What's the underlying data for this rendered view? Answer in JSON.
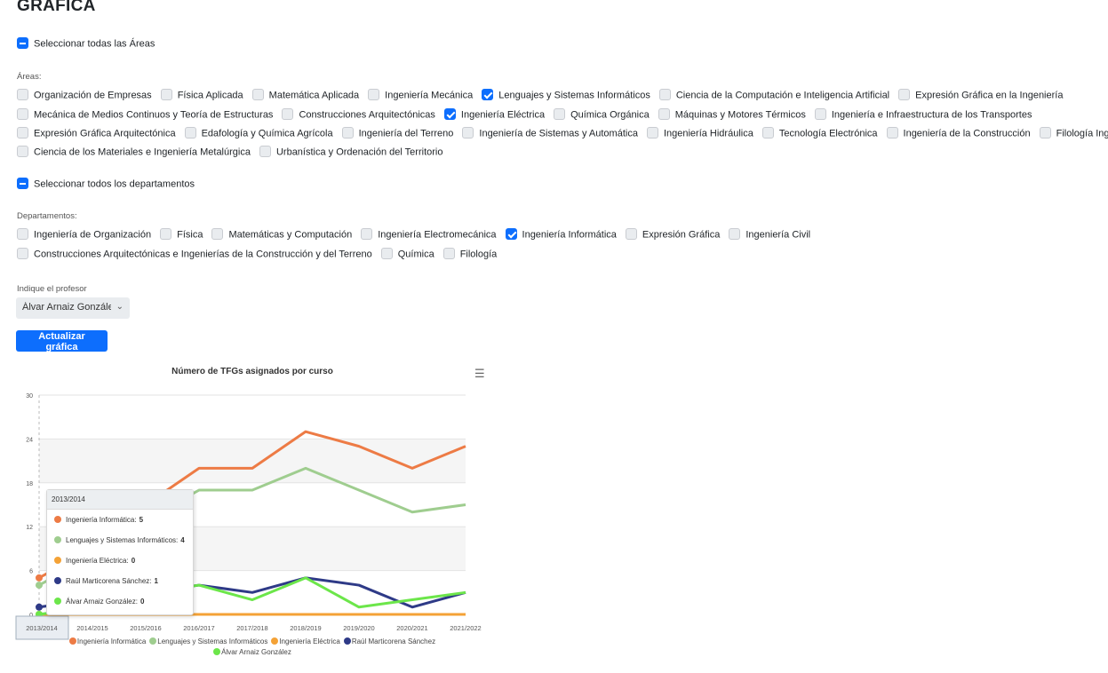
{
  "page": {
    "title": "GRÁFICA"
  },
  "areas": {
    "select_all_label": "Seleccionar todas las Áreas",
    "section_label": "Áreas:",
    "rows": [
      [
        {
          "label": "Organización de Empresas",
          "checked": false
        },
        {
          "label": "Física Aplicada",
          "checked": false
        },
        {
          "label": "Matemática Aplicada",
          "checked": false
        },
        {
          "label": "Ingeniería Mecánica",
          "checked": false
        },
        {
          "label": "Lenguajes y Sistemas Informáticos",
          "checked": true
        },
        {
          "label": "Ciencia de la Computación e Inteligencia Artificial",
          "checked": false
        },
        {
          "label": "Expresión Gráfica en la Ingeniería",
          "checked": false
        }
      ],
      [
        {
          "label": "Mecánica de Medios Continuos y Teoría de Estructuras",
          "checked": false
        },
        {
          "label": "Construcciones Arquitectónicas",
          "checked": false
        },
        {
          "label": "Ingeniería Eléctrica",
          "checked": true
        },
        {
          "label": "Química Orgánica",
          "checked": false
        },
        {
          "label": "Máquinas y Motores Térmicos",
          "checked": false
        },
        {
          "label": "Ingeniería e Infraestructura de los Transportes",
          "checked": false
        }
      ],
      [
        {
          "label": "Expresión Gráfica Arquitectónica",
          "checked": false
        },
        {
          "label": "Edafología y Química Agrícola",
          "checked": false
        },
        {
          "label": "Ingeniería del Terreno",
          "checked": false
        },
        {
          "label": "Ingeniería de Sistemas y Automática",
          "checked": false
        },
        {
          "label": "Ingeniería Hidráulica",
          "checked": false
        },
        {
          "label": "Tecnología Electrónica",
          "checked": false
        },
        {
          "label": "Ingeniería de la Construcción",
          "checked": false
        },
        {
          "label": "Filología Inglesa",
          "checked": false
        }
      ],
      [
        {
          "label": "Ciencia de los Materiales e Ingeniería Metalúrgica",
          "checked": false
        },
        {
          "label": "Urbanística y Ordenación del Territorio",
          "checked": false
        }
      ]
    ]
  },
  "departments": {
    "select_all_label": "Seleccionar todos los departamentos",
    "section_label": "Departamentos:",
    "rows": [
      [
        {
          "label": "Ingeniería de Organización",
          "checked": false
        },
        {
          "label": "Física",
          "checked": false
        },
        {
          "label": "Matemáticas y Computación",
          "checked": false
        },
        {
          "label": "Ingeniería Electromecánica",
          "checked": false
        },
        {
          "label": "Ingeniería Informática",
          "checked": true
        },
        {
          "label": "Expresión Gráfica",
          "checked": false
        },
        {
          "label": "Ingeniería Civil",
          "checked": false
        }
      ],
      [
        {
          "label": "Construcciones Arquitectónicas e Ingenierías de la Construcción y del Terreno",
          "checked": false
        },
        {
          "label": "Química",
          "checked": false
        },
        {
          "label": "Filología",
          "checked": false
        }
      ]
    ]
  },
  "professor": {
    "label": "Indique el profesor",
    "selected": "Álvar Arnaiz González"
  },
  "update_button": {
    "label": "Actualizar gráfica"
  },
  "chart_data": {
    "type": "line",
    "title": "Número de TFGs asignados por curso",
    "xlabel": "",
    "ylabel": "",
    "ylim": [
      0,
      30
    ],
    "yticks": [
      0,
      6,
      12,
      18,
      24,
      30
    ],
    "categories": [
      "2013/2014",
      "2014/2015",
      "2015/2016",
      "2016/2017",
      "2017/2018",
      "2018/2019",
      "2019/2020",
      "2020/2021",
      "2021/2022"
    ],
    "series": [
      {
        "name": "Ingeniería Informática",
        "color": "#ed7b45",
        "values": [
          5,
          9,
          15,
          20,
          20,
          25,
          23,
          20,
          23
        ]
      },
      {
        "name": "Lenguajes y Sistemas Informáticos",
        "color": "#9fcd8f",
        "values": [
          4,
          8,
          13,
          17,
          17,
          20,
          17,
          14,
          15
        ]
      },
      {
        "name": "Ingeniería Eléctrica",
        "color": "#f4a236",
        "values": [
          0,
          0,
          0,
          0,
          0,
          0,
          0,
          0,
          0
        ]
      },
      {
        "name": "Raúl Marticorena Sánchez",
        "color": "#2e3a87",
        "values": [
          1,
          2,
          3,
          4,
          3,
          5,
          4,
          1,
          3
        ]
      },
      {
        "name": "Álvar Arnaiz González",
        "color": "#6ce64a",
        "values": [
          0,
          1,
          3,
          4,
          2,
          5,
          1,
          2,
          3
        ]
      }
    ],
    "grid": true,
    "legend_position": "bottom",
    "highlighted_category": "2013/2014",
    "tooltip": {
      "header": "2013/2014",
      "rows": [
        {
          "label": "Ingeniería Informática:",
          "value": "5"
        },
        {
          "label": "Lenguajes y Sistemas Informáticos:",
          "value": "4"
        },
        {
          "label": "Ingeniería Eléctrica:",
          "value": "0"
        },
        {
          "label": "Raúl Marticorena Sánchez:",
          "value": "1"
        },
        {
          "label": "Álvar Arnaiz González:",
          "value": "0"
        }
      ]
    }
  }
}
